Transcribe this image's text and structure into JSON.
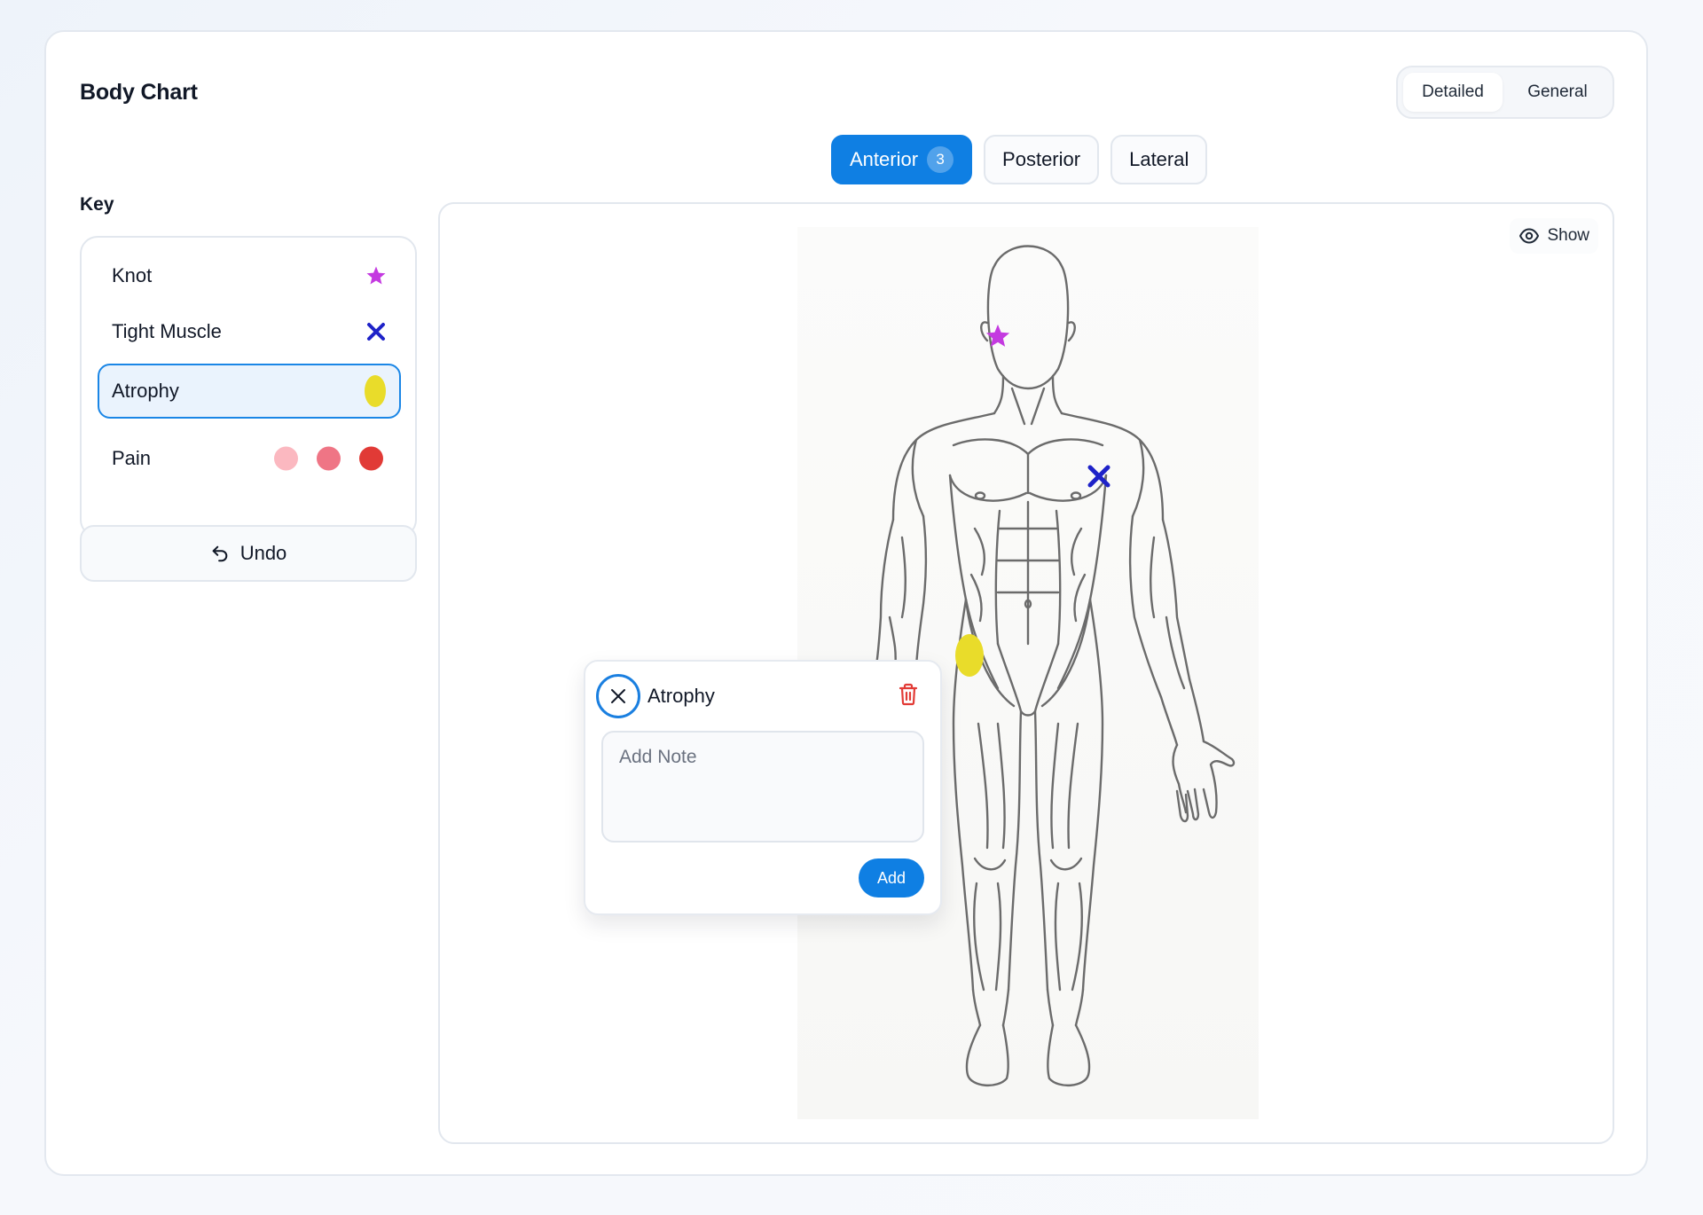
{
  "header": {
    "title": "Body Chart",
    "modes": [
      {
        "label": "Detailed",
        "active": true
      },
      {
        "label": "General",
        "active": false
      }
    ]
  },
  "view_tabs": [
    {
      "label": "Anterior",
      "count": "3",
      "active": true
    },
    {
      "label": "Posterior",
      "active": false
    },
    {
      "label": "Lateral",
      "active": false
    }
  ],
  "key": {
    "title": "Key",
    "items": [
      {
        "label": "Knot",
        "symbol": "star-icon",
        "color": "#c43ae0"
      },
      {
        "label": "Tight Muscle",
        "symbol": "x-mark-icon",
        "color": "#1e22c8"
      },
      {
        "label": "Atrophy",
        "symbol": "oval-icon",
        "color": "#e9dc2a",
        "selected": true
      },
      {
        "label": "Pain",
        "symbol": "dots",
        "colors": [
          "#fbb8c0",
          "#ef7585",
          "#e13a36"
        ]
      }
    ]
  },
  "undo": {
    "label": "Undo"
  },
  "canvas": {
    "show_label": "Show",
    "markers": [
      {
        "type": "knot",
        "color": "#c43ae0"
      },
      {
        "type": "tight-muscle",
        "color": "#1e22c8"
      },
      {
        "type": "atrophy",
        "color": "#e9dc2a"
      }
    ]
  },
  "popup": {
    "title": "Atrophy",
    "note_placeholder": "Add Note",
    "note_value": "",
    "add_label": "Add"
  }
}
